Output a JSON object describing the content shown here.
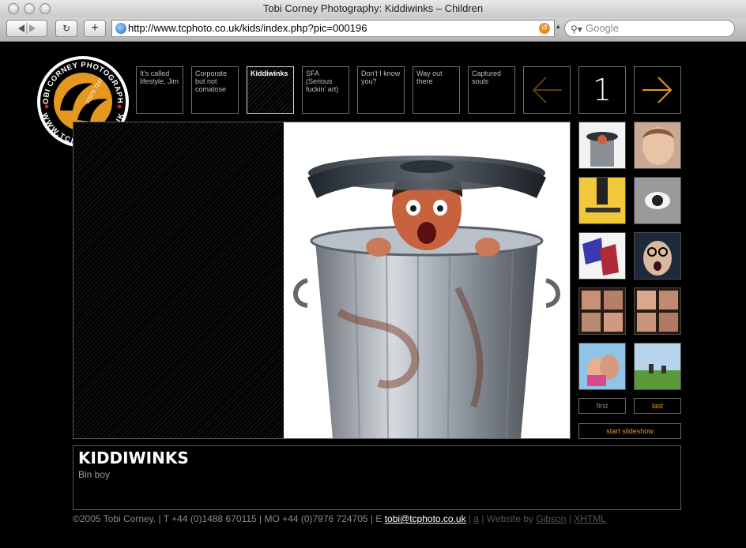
{
  "browser": {
    "title": "Tobi Corney Photography: Kiddiwinks – Children",
    "url": "http://www.tcphoto.co.uk/kids/index.php?pic=000196",
    "search_placeholder": "Google",
    "back_glyph": "◀ ▶",
    "reload_glyph": "↻",
    "add_glyph": "+"
  },
  "logo": {
    "top_text": "TOBI CORNEY PHOTOGRAPHY",
    "bottom_text": "WWW.TCPHOTO.CO.UK",
    "phone_text": "07976 724705"
  },
  "nav": {
    "items": [
      {
        "label": "It's called lifestyle, Jim"
      },
      {
        "label": "Corporate but not comatose"
      },
      {
        "label": "Kiddiwinks"
      },
      {
        "label": "SFA (Serious fuckin' art)"
      },
      {
        "label": "Don't I know you?"
      },
      {
        "label": "Way out there"
      },
      {
        "label": "Captured souls"
      }
    ],
    "page_number": "1"
  },
  "thumbs": {
    "first_label": "first",
    "last_label": "last",
    "slideshow_label": "start slideshow"
  },
  "caption": {
    "title": "KIDDIWINKS",
    "subtitle": "Bin boy"
  },
  "footer": {
    "text": "©2005 Tobi Corney. | T +44 (0)1488 670115 | MO +44 (0)7976 724705 | E ",
    "email": "tobi@tcphoto.co.uk",
    "sep1": " | ",
    "a_link": "a",
    "sep2": " | Website by ",
    "gibson": "Gibson",
    "sep3": " | ",
    "xhtml": "XHTML"
  },
  "colors": {
    "accent": "#e4981f",
    "background": "#000000"
  }
}
